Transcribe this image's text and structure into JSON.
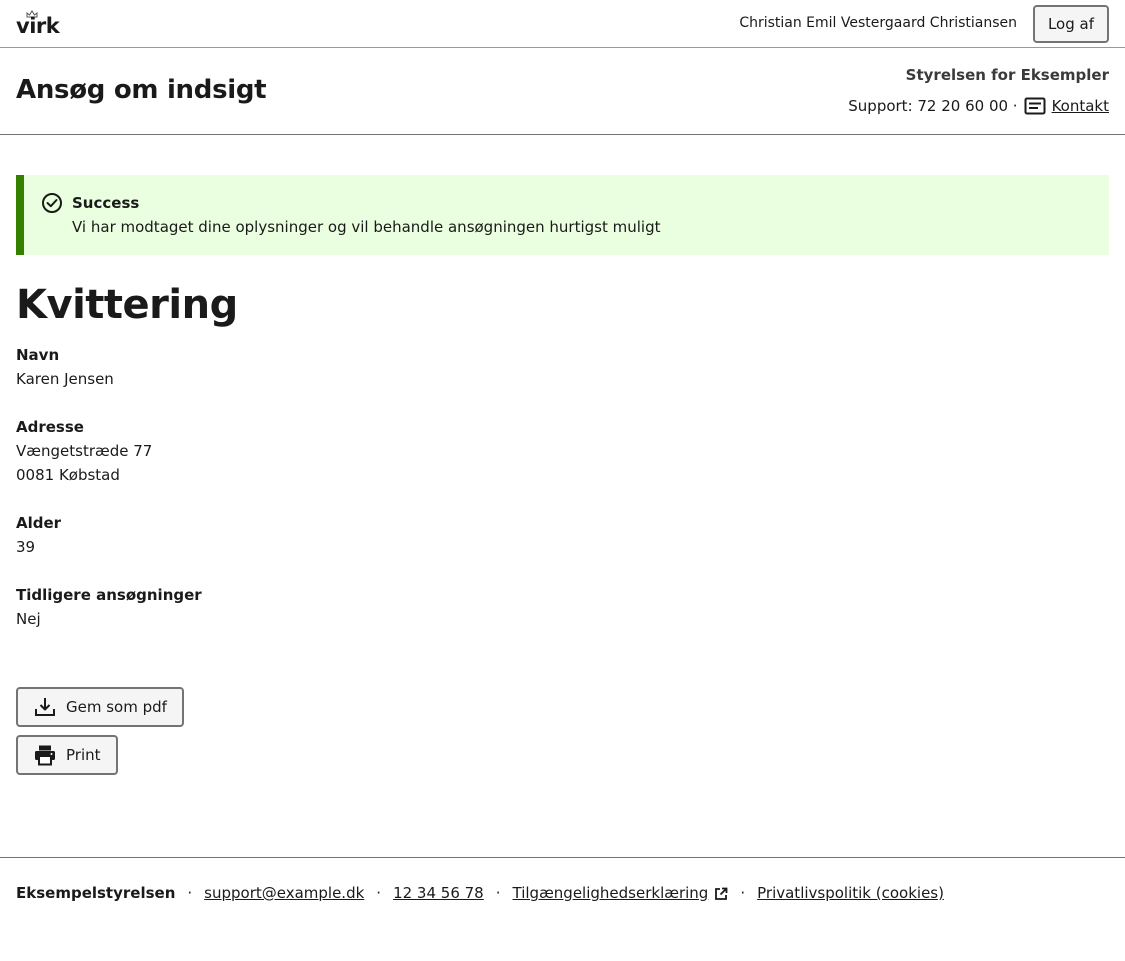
{
  "topbar": {
    "logo_text": "virk",
    "user_name": "Christian Emil Vestergaard Christiansen",
    "logout_label": "Log af"
  },
  "header": {
    "title": "Ansøg om indsigt",
    "authority": "Styrelsen for Eksempler",
    "support_text": "Support: 72 20 60 00 ·",
    "contact_label": "Kontakt"
  },
  "alert": {
    "heading": "Success",
    "message": "Vi har modtaget dine oplysninger og vil behandle ansøgningen hurtigst muligt",
    "accent_color": "#358000",
    "background_color": "#eaffdf"
  },
  "receipt": {
    "title": "Kvittering",
    "fields": [
      {
        "label": "Navn",
        "values": [
          "Karen Jensen"
        ]
      },
      {
        "label": "Adresse",
        "values": [
          "Vængetstræde 77",
          "0081 Købstad"
        ]
      },
      {
        "label": "Alder",
        "values": [
          "39"
        ]
      },
      {
        "label": "Tidligere ansøgninger",
        "values": [
          "Nej"
        ]
      }
    ]
  },
  "actions": {
    "save_pdf_label": "Gem som pdf",
    "save_pdf_icon": "download-icon",
    "print_label": "Print",
    "print_icon": "printer-icon"
  },
  "footer": {
    "org": "Eksempelstyrelsen",
    "email": "support@example.dk",
    "phone": "12 34 56 78",
    "accessibility_label": "Tilgængelighedserklæring",
    "privacy_label": "Privatlivspolitik (cookies)",
    "separator": "·"
  }
}
